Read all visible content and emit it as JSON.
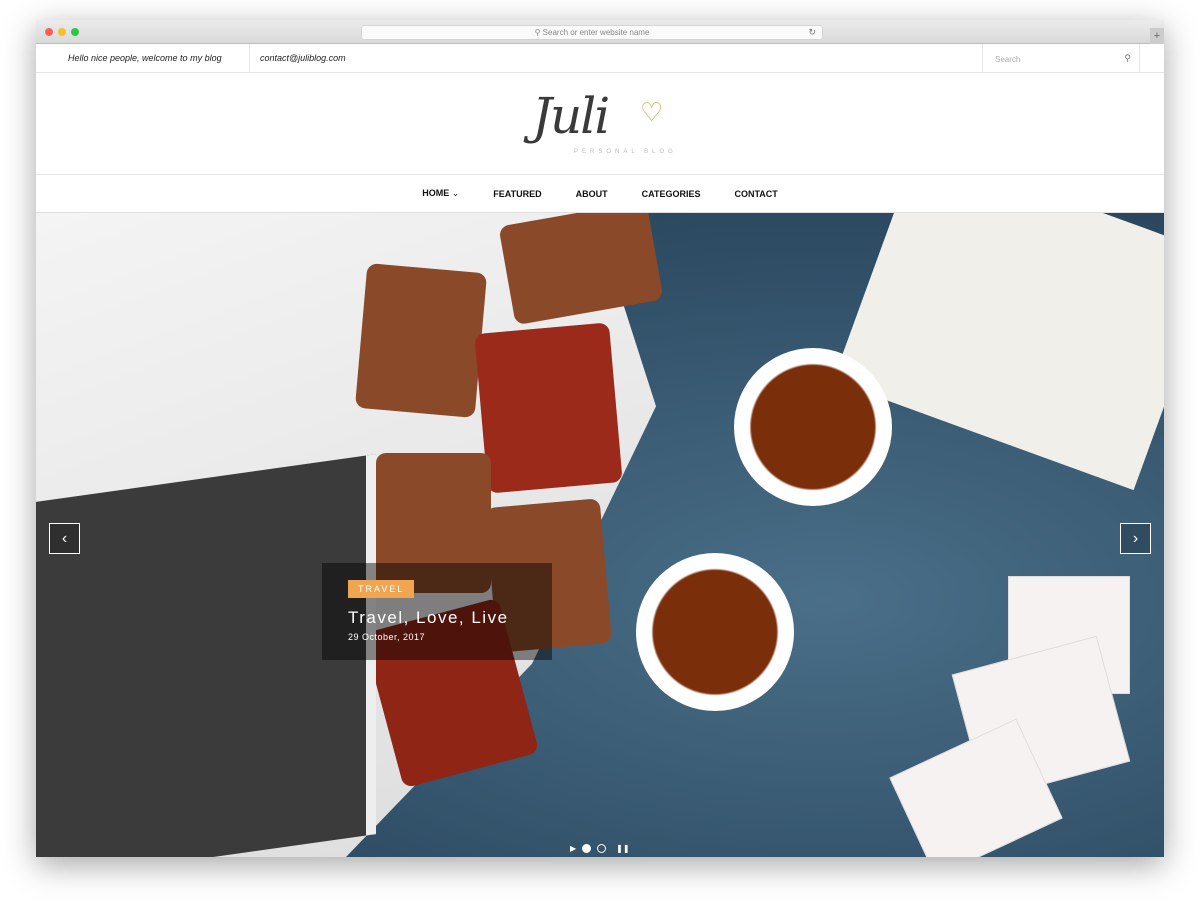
{
  "browser": {
    "url_placeholder": "Search or enter website name"
  },
  "topbar": {
    "greeting": "Hello nice people, welcome to my blog",
    "email": "contact@juliblog.com",
    "search_placeholder": "Search"
  },
  "logo": {
    "name": "Juli",
    "tagline": "PERSONAL BLOG"
  },
  "nav": {
    "items": [
      {
        "label": "HOME"
      },
      {
        "label": "FEATURED"
      },
      {
        "label": "ABOUT"
      },
      {
        "label": "CATEGORIES"
      },
      {
        "label": "CONTACT"
      }
    ]
  },
  "slider": {
    "category": "TRAVEL",
    "title": "Travel, Love, Live",
    "date": "29 October, 2017",
    "active_slide": 1,
    "slide_count": 2,
    "accent": "#f2a550"
  }
}
